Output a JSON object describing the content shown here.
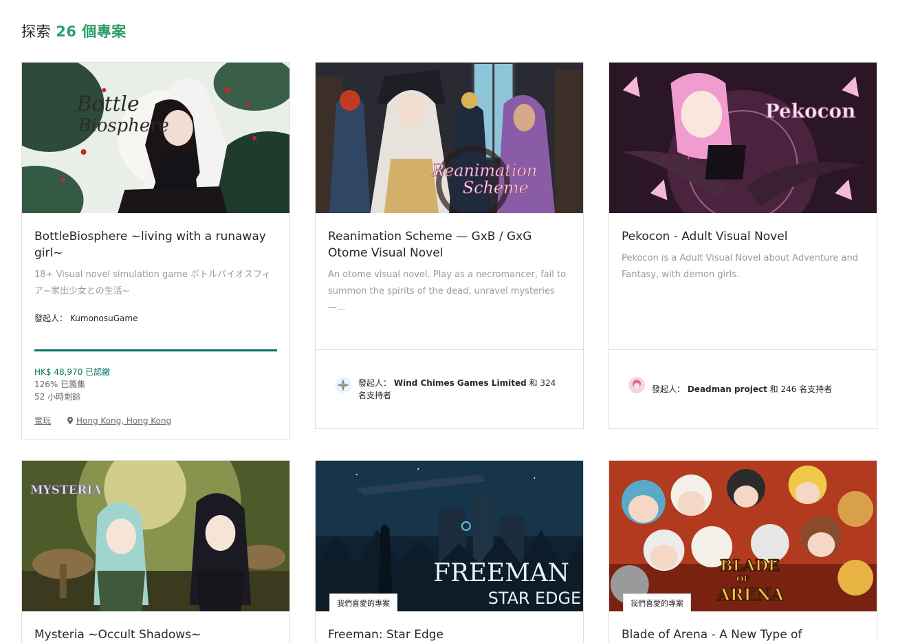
{
  "header": {
    "prefix": "探索",
    "count": "26 個專案"
  },
  "cards": [
    {
      "image_text": [
        "Bottle",
        "Biosphere"
      ],
      "title": "BottleBiosphere ~living with a runaway girl~",
      "blurb": "18+ Visual novel simulation game ボトルバイオスフィア~家出少女との生活~",
      "creator_label": "發起人：",
      "creator": "KumonosuGame",
      "progress_percent": 100,
      "pledged": "HK$ 48,970 已認繳",
      "funded": "126% 已籌集",
      "remaining": "52 小時剩餘",
      "category": "電玩",
      "location": "Hong Kong, Hong Kong"
    },
    {
      "image_text": [
        "Reanimation",
        "Scheme"
      ],
      "title": "Reanimation Scheme — GxB / GxG Otome Visual Novel",
      "blurb": "An otome visual novel. Play as a necromancer, fail to summon the spirits of the dead, unravel mysteries —...",
      "creator_label": "發起人：",
      "creator": "Wind Chimes Games Limited",
      "backers": "和 324 名支持者"
    },
    {
      "image_text": [
        "Pekocon"
      ],
      "title": "Pekocon - Adult Visual Novel",
      "blurb": "Pekocon is a Adult Visual Novel about Adventure and Fantasy, with demon girls.",
      "creator_label": "發起人：",
      "creator": "Deadman project",
      "backers": "和 246 名支持者"
    },
    {
      "image_text": [
        "MYSTERIA"
      ],
      "title": "Mysteria ~Occult Shadows~"
    },
    {
      "image_text": [
        "FREEMAN",
        "STAR EDGE"
      ],
      "badge": "我們喜愛的專案",
      "title": "Freeman: Star Edge"
    },
    {
      "image_text": [
        "BLADE",
        "OF",
        "ARENA"
      ],
      "badge": "我們喜愛的專案",
      "title": "Blade of Arena - A New Type of"
    }
  ],
  "colors": {
    "accent": "#2e9d6b",
    "progress": "#037362",
    "border": "#dcdedd",
    "muted": "#9a9a9a"
  }
}
